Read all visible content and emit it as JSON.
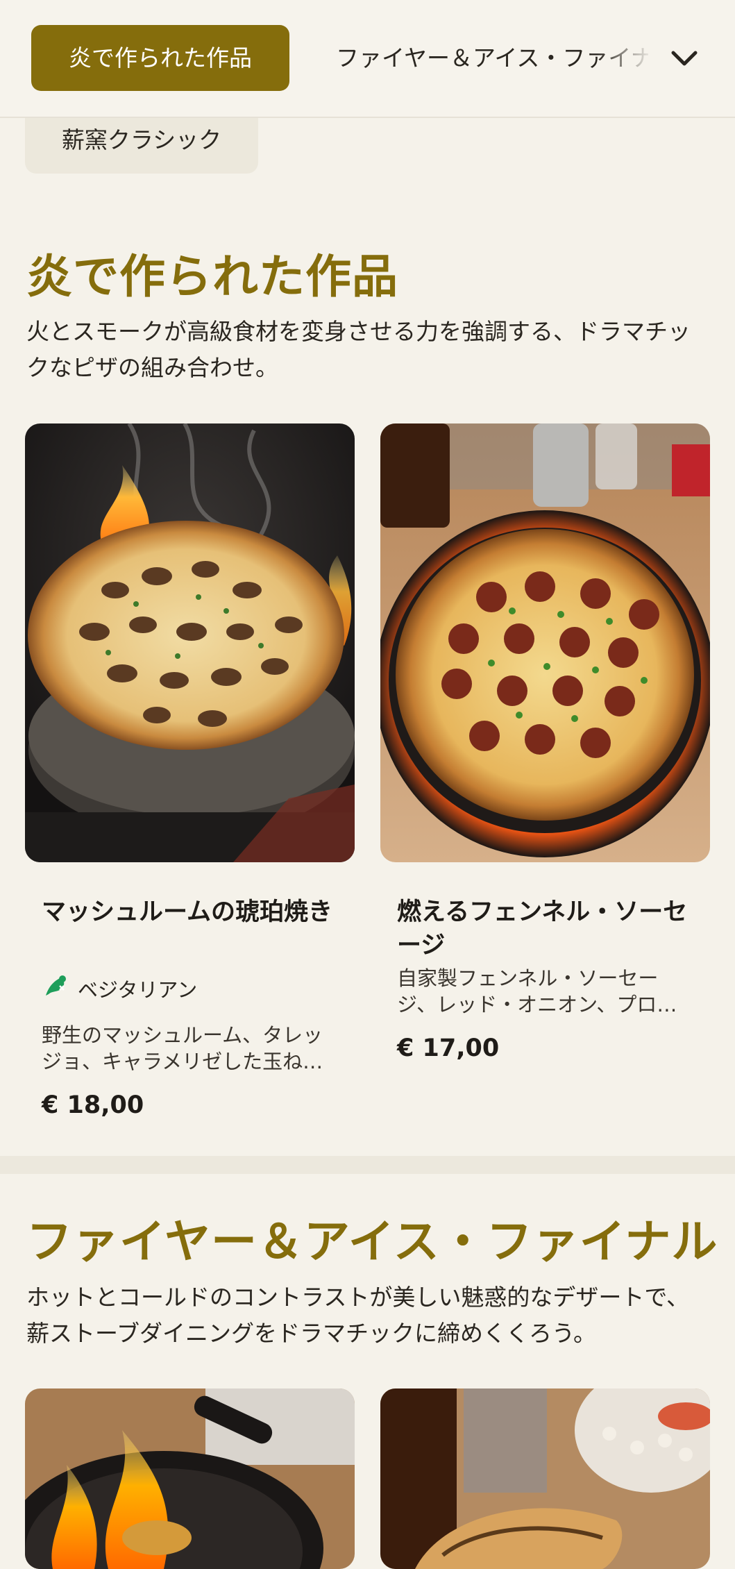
{
  "nav": {
    "active_tab": "炎で作られた作品",
    "next_tab": "ファイヤー＆アイス・ファイナル",
    "sub_tab": "薪窯クラシック"
  },
  "sections": [
    {
      "title": "炎で作られた作品",
      "description": "火とスモークが高級食材を変身させる力を強調する、ドラマチックなピザの組み合わせ。",
      "items": [
        {
          "name": "マッシュルームの琥珀焼き",
          "tag": "ベジタリアン",
          "description": "野生のマッシュルーム、タレッジョ、キャラメリゼした玉ね…",
          "price": "€ 18,00"
        },
        {
          "name": "燃えるフェンネル・ソーセージ",
          "description": "自家製フェンネル・ソーセージ、レッド・オニオン、プロ…",
          "price": "€ 17,00"
        }
      ]
    },
    {
      "title": "ファイヤー＆アイス・ファイナル",
      "description": "ホットとコールドのコントラストが美しい魅惑的なデザートで、薪ストーブダイニングをドラマチックに締めくくろう。"
    }
  ],
  "icons": {
    "chevron": "chevron-down-icon",
    "vegetarian": "vegetarian-icon"
  },
  "colors": {
    "accent": "#856d0c",
    "background": "#f5f2ea",
    "vegetarian": "#1e9e5a"
  }
}
